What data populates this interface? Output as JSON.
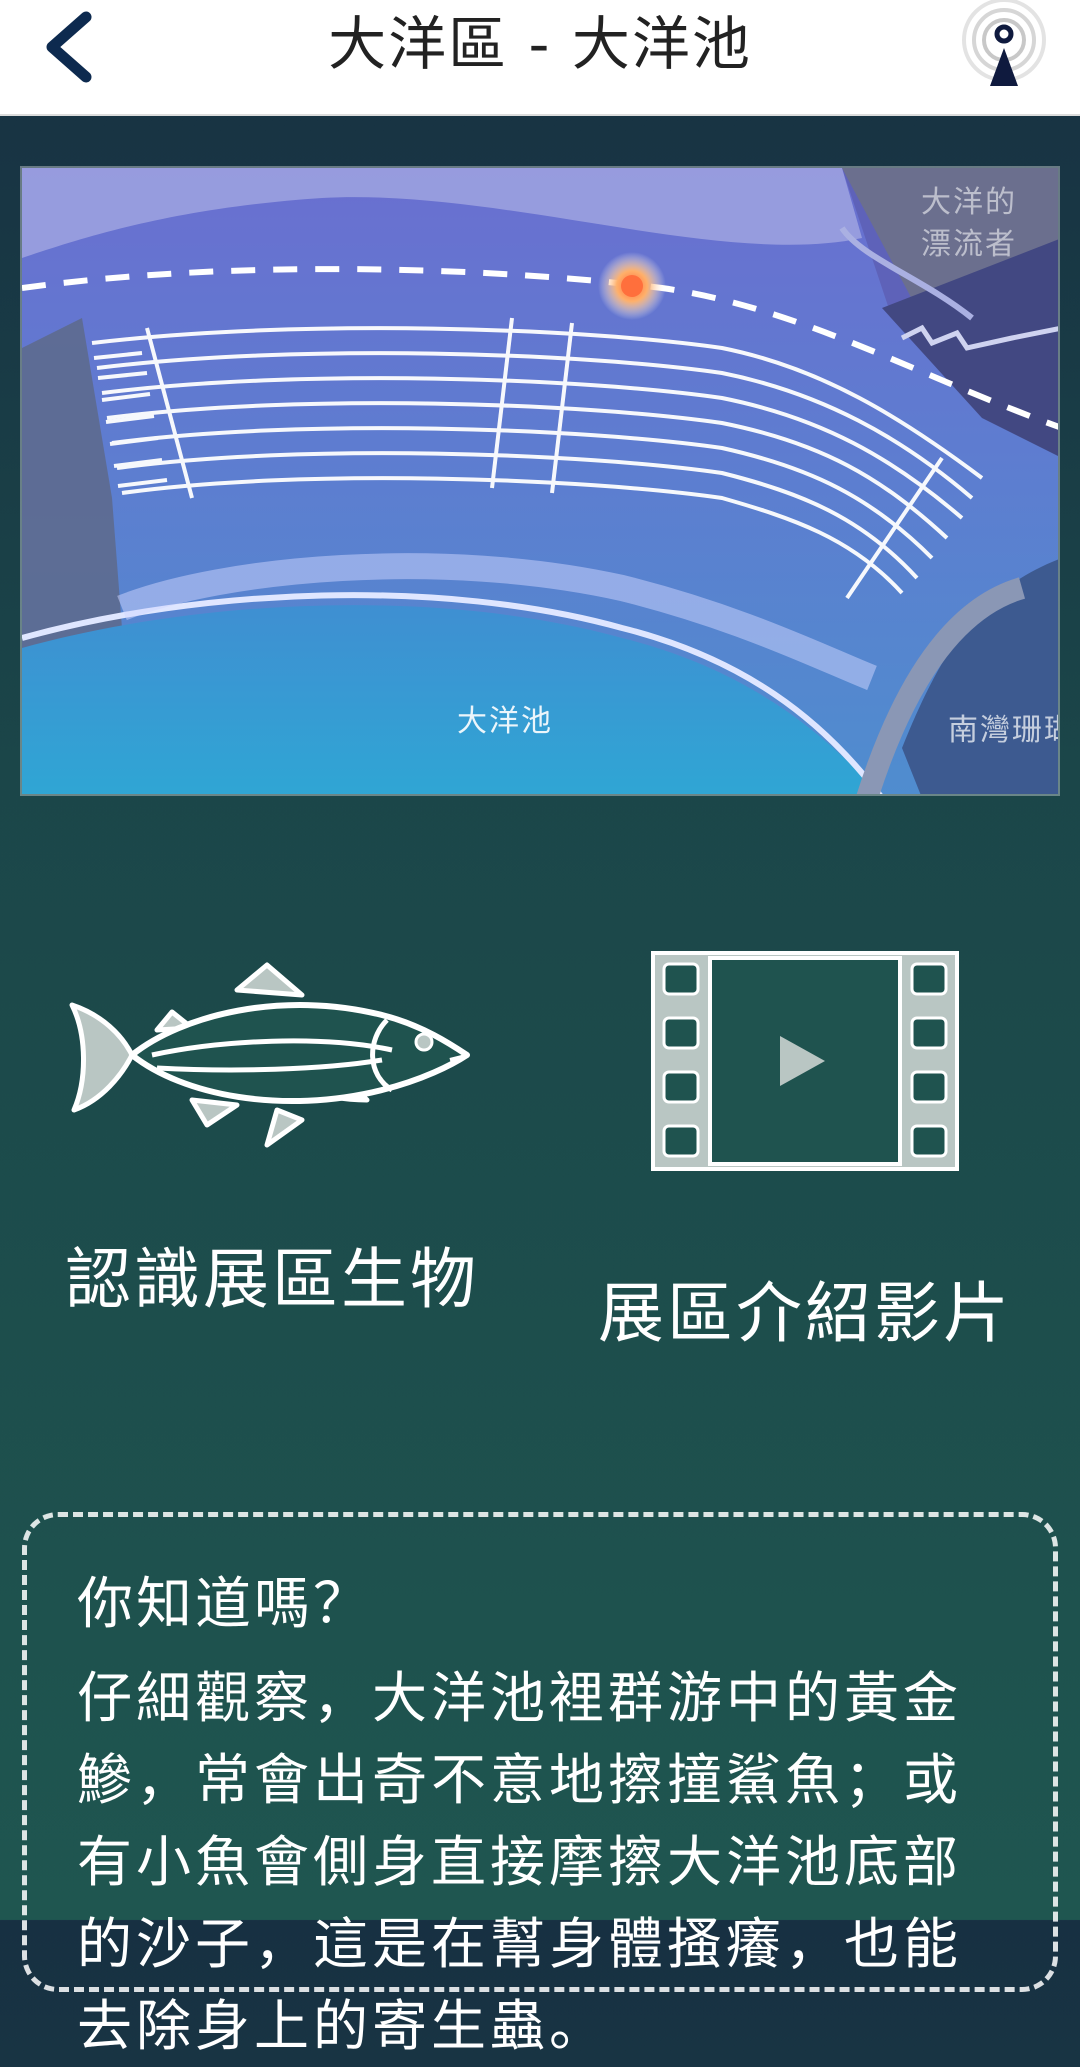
{
  "header": {
    "title": "大洋區 - 大洋池",
    "back_icon": "chevron-left-icon",
    "beacon_icon": "location-beacon-icon",
    "accent": "#0d2a4f"
  },
  "map": {
    "labels": {
      "drifters": "大洋的漂流者",
      "pool": "大洋池",
      "bay": "南灣珊瑚"
    },
    "marker": "current-location-dot"
  },
  "tiles": {
    "creatures": {
      "label": "認識展區生物",
      "icon": "fish-icon"
    },
    "video": {
      "label": "展區介紹影片",
      "icon": "film-play-icon"
    }
  },
  "tip": {
    "title": "你知道嗎？",
    "body": "仔細觀察，大洋池裡群游中的黃金鰺，常會出奇不意地擦撞鯊魚；或有小魚會側身直接摩擦大洋池底部的沙子，這是在幫身體搔癢，也能去除身上的寄生蟲。"
  }
}
